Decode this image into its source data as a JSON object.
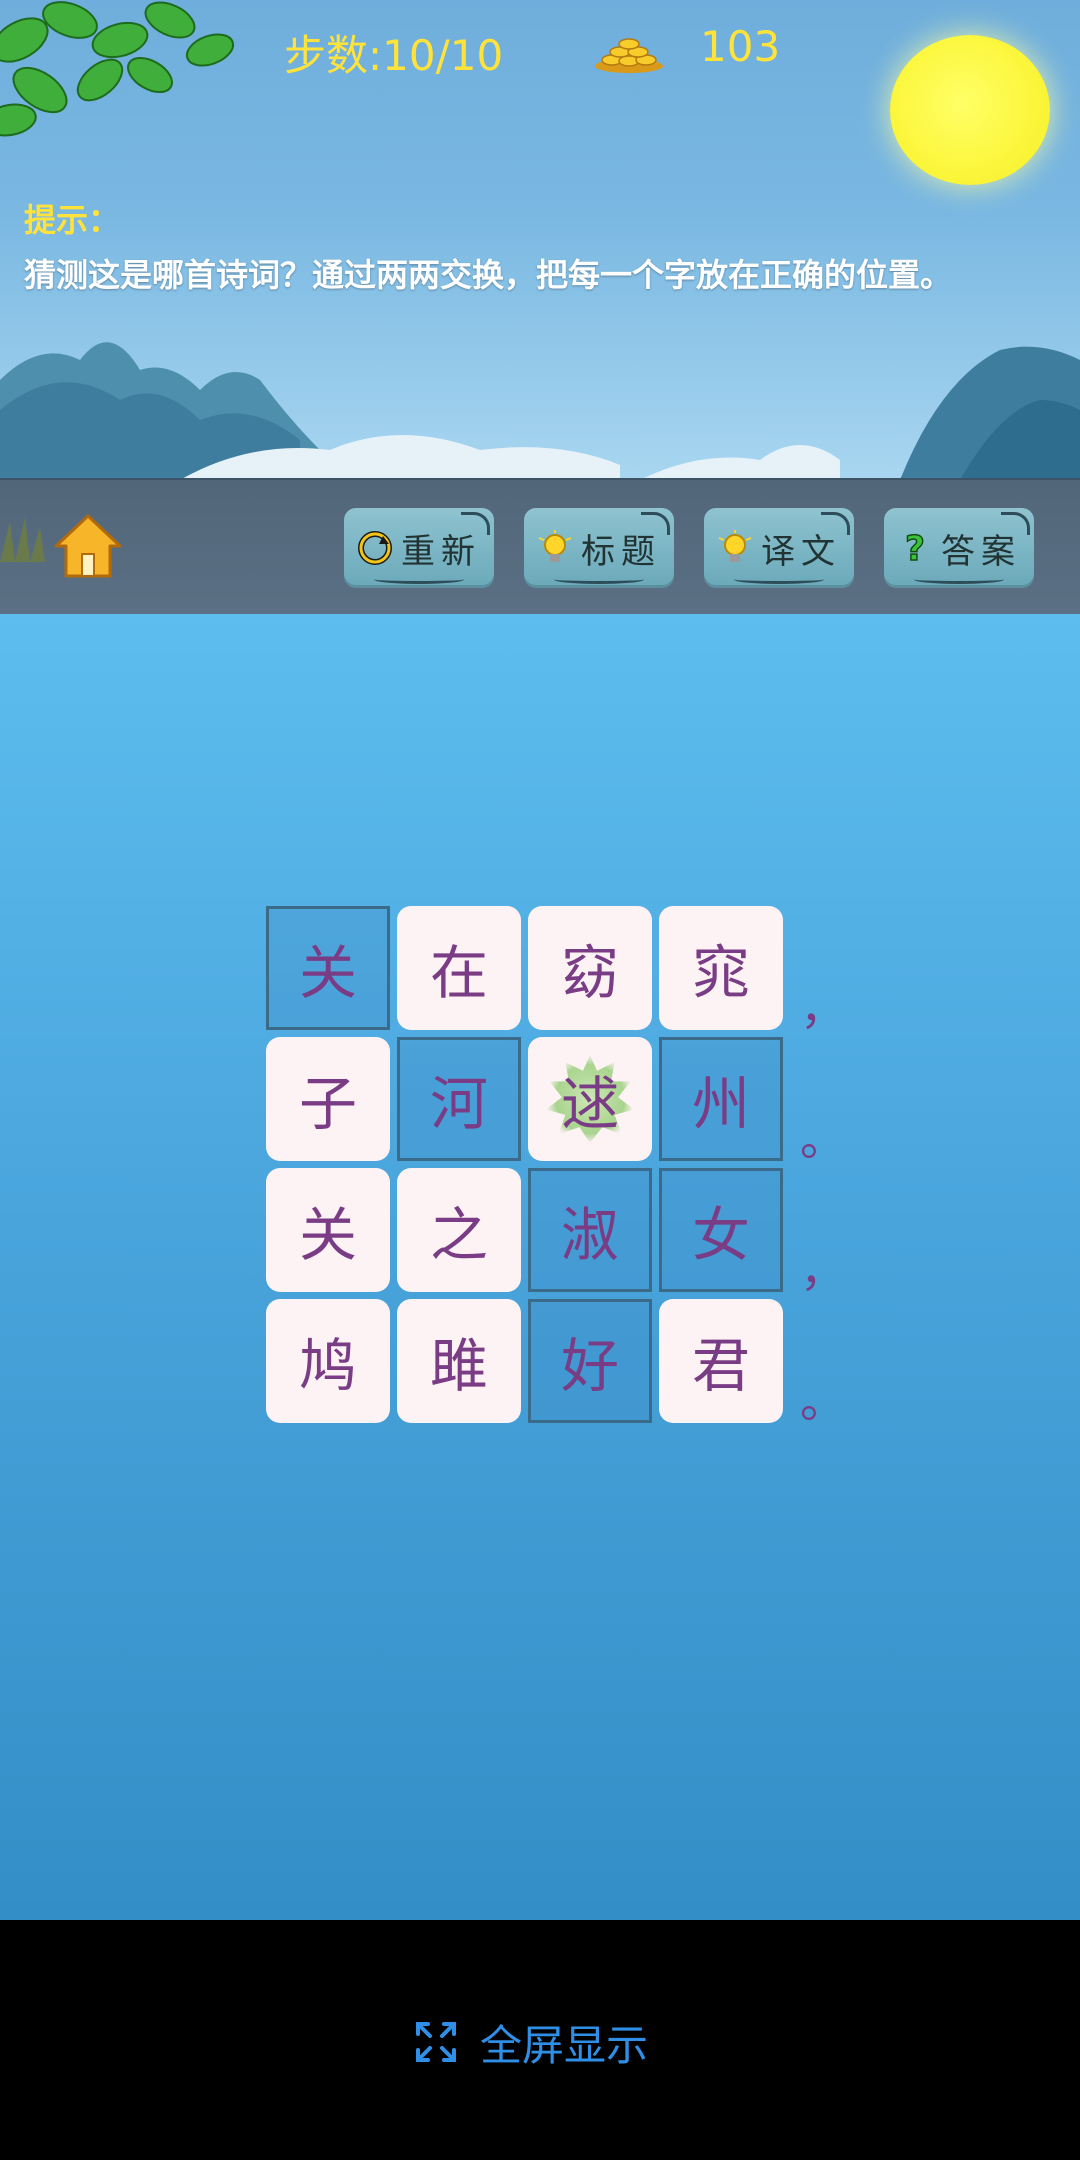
{
  "status": {
    "steps": "步数:10/10",
    "coins": "103"
  },
  "hint": {
    "title": "提示：",
    "text": "猜测这是哪首诗词？通过两两交换，把每一个字放在正确的位置。"
  },
  "toolbar": {
    "restart_label": "重新",
    "title_label": "标题",
    "translation_label": "译文",
    "answer_label": "答案"
  },
  "grid": {
    "rows": [
      [
        {
          "char": "关",
          "state": "slot"
        },
        {
          "char": "在",
          "state": "tile"
        },
        {
          "char": "窈",
          "state": "tile"
        },
        {
          "char": "窕",
          "state": "tile"
        }
      ],
      [
        {
          "char": "子",
          "state": "tile"
        },
        {
          "char": "河",
          "state": "slot"
        },
        {
          "char": "逑",
          "state": "selected"
        },
        {
          "char": "州",
          "state": "slot"
        }
      ],
      [
        {
          "char": "关",
          "state": "tile"
        },
        {
          "char": "之",
          "state": "tile"
        },
        {
          "char": "淑",
          "state": "slot"
        },
        {
          "char": "女",
          "state": "slot"
        }
      ],
      [
        {
          "char": "鸠",
          "state": "tile"
        },
        {
          "char": "雎",
          "state": "tile"
        },
        {
          "char": "好",
          "state": "slot"
        },
        {
          "char": "君",
          "state": "tile"
        }
      ]
    ],
    "punctuation": [
      "，",
      "。",
      "，",
      "。"
    ]
  },
  "bottom": {
    "fullscreen_label": "全屏显示"
  },
  "colors": {
    "accent_yellow": "#ffe33a",
    "tile_text": "#7a3d85",
    "link_blue": "#2f8fe6"
  },
  "icons": [
    "home-icon",
    "coin-pile-icon",
    "restart-icon",
    "lightbulb-icon",
    "question-icon",
    "expand-icon",
    "moon-icon"
  ]
}
